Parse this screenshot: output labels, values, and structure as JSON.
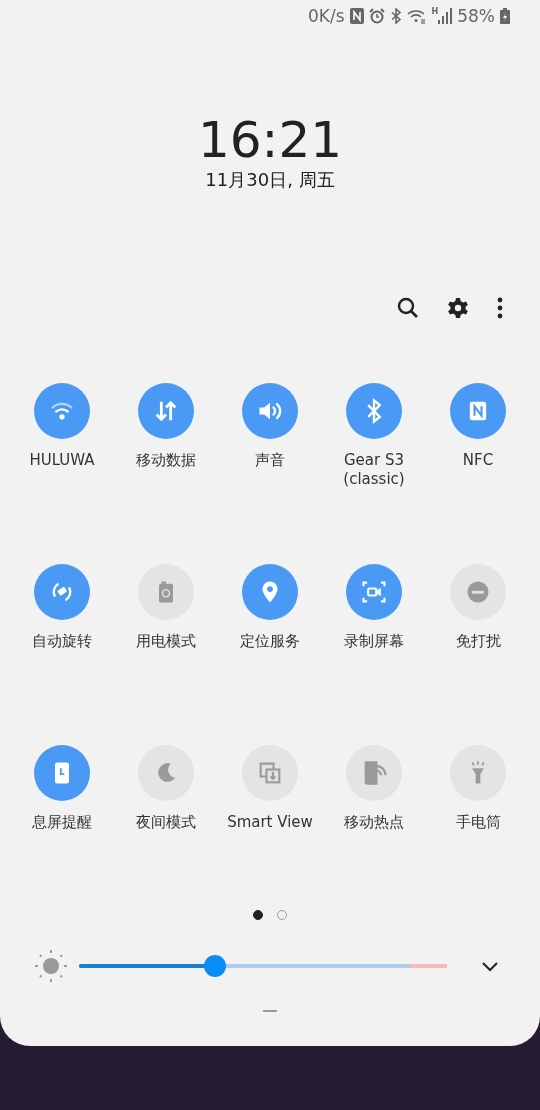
{
  "status_bar": {
    "speed": "0K/s",
    "network_type": "H",
    "battery": "58%"
  },
  "clock": {
    "time": "16:21",
    "date": "11月30日, 周五"
  },
  "toolbar": [
    {
      "kind": "search"
    },
    {
      "kind": "settings"
    },
    {
      "kind": "more"
    }
  ],
  "tiles": [
    {
      "label": "HULUWA",
      "kind": "wifi",
      "on": true
    },
    {
      "label": "移动数据",
      "kind": "data",
      "on": true
    },
    {
      "label": "声音",
      "kind": "sound",
      "on": true
    },
    {
      "label": "Gear S3\n(classic)",
      "kind": "bluetooth",
      "on": true
    },
    {
      "label": "NFC",
      "kind": "nfc",
      "on": true
    },
    {
      "label": "自动旋转",
      "kind": "rotate",
      "on": true
    },
    {
      "label": "用电模式",
      "kind": "battery",
      "on": false
    },
    {
      "label": "定位服务",
      "kind": "location",
      "on": true
    },
    {
      "label": "录制屏幕",
      "kind": "record",
      "on": true
    },
    {
      "label": "免打扰",
      "kind": "dnd",
      "on": false
    },
    {
      "label": "息屏提醒",
      "kind": "aod",
      "on": true
    },
    {
      "label": "夜间模式",
      "kind": "night",
      "on": false
    },
    {
      "label": "Smart View",
      "kind": "smartview",
      "on": false
    },
    {
      "label": "移动热点",
      "kind": "hotspot",
      "on": false
    },
    {
      "label": "手电筒",
      "kind": "flashlight",
      "on": false
    }
  ],
  "pages": [
    {
      "selected": true
    },
    {
      "selected": false
    }
  ],
  "brightness": {
    "level": 0.36
  }
}
